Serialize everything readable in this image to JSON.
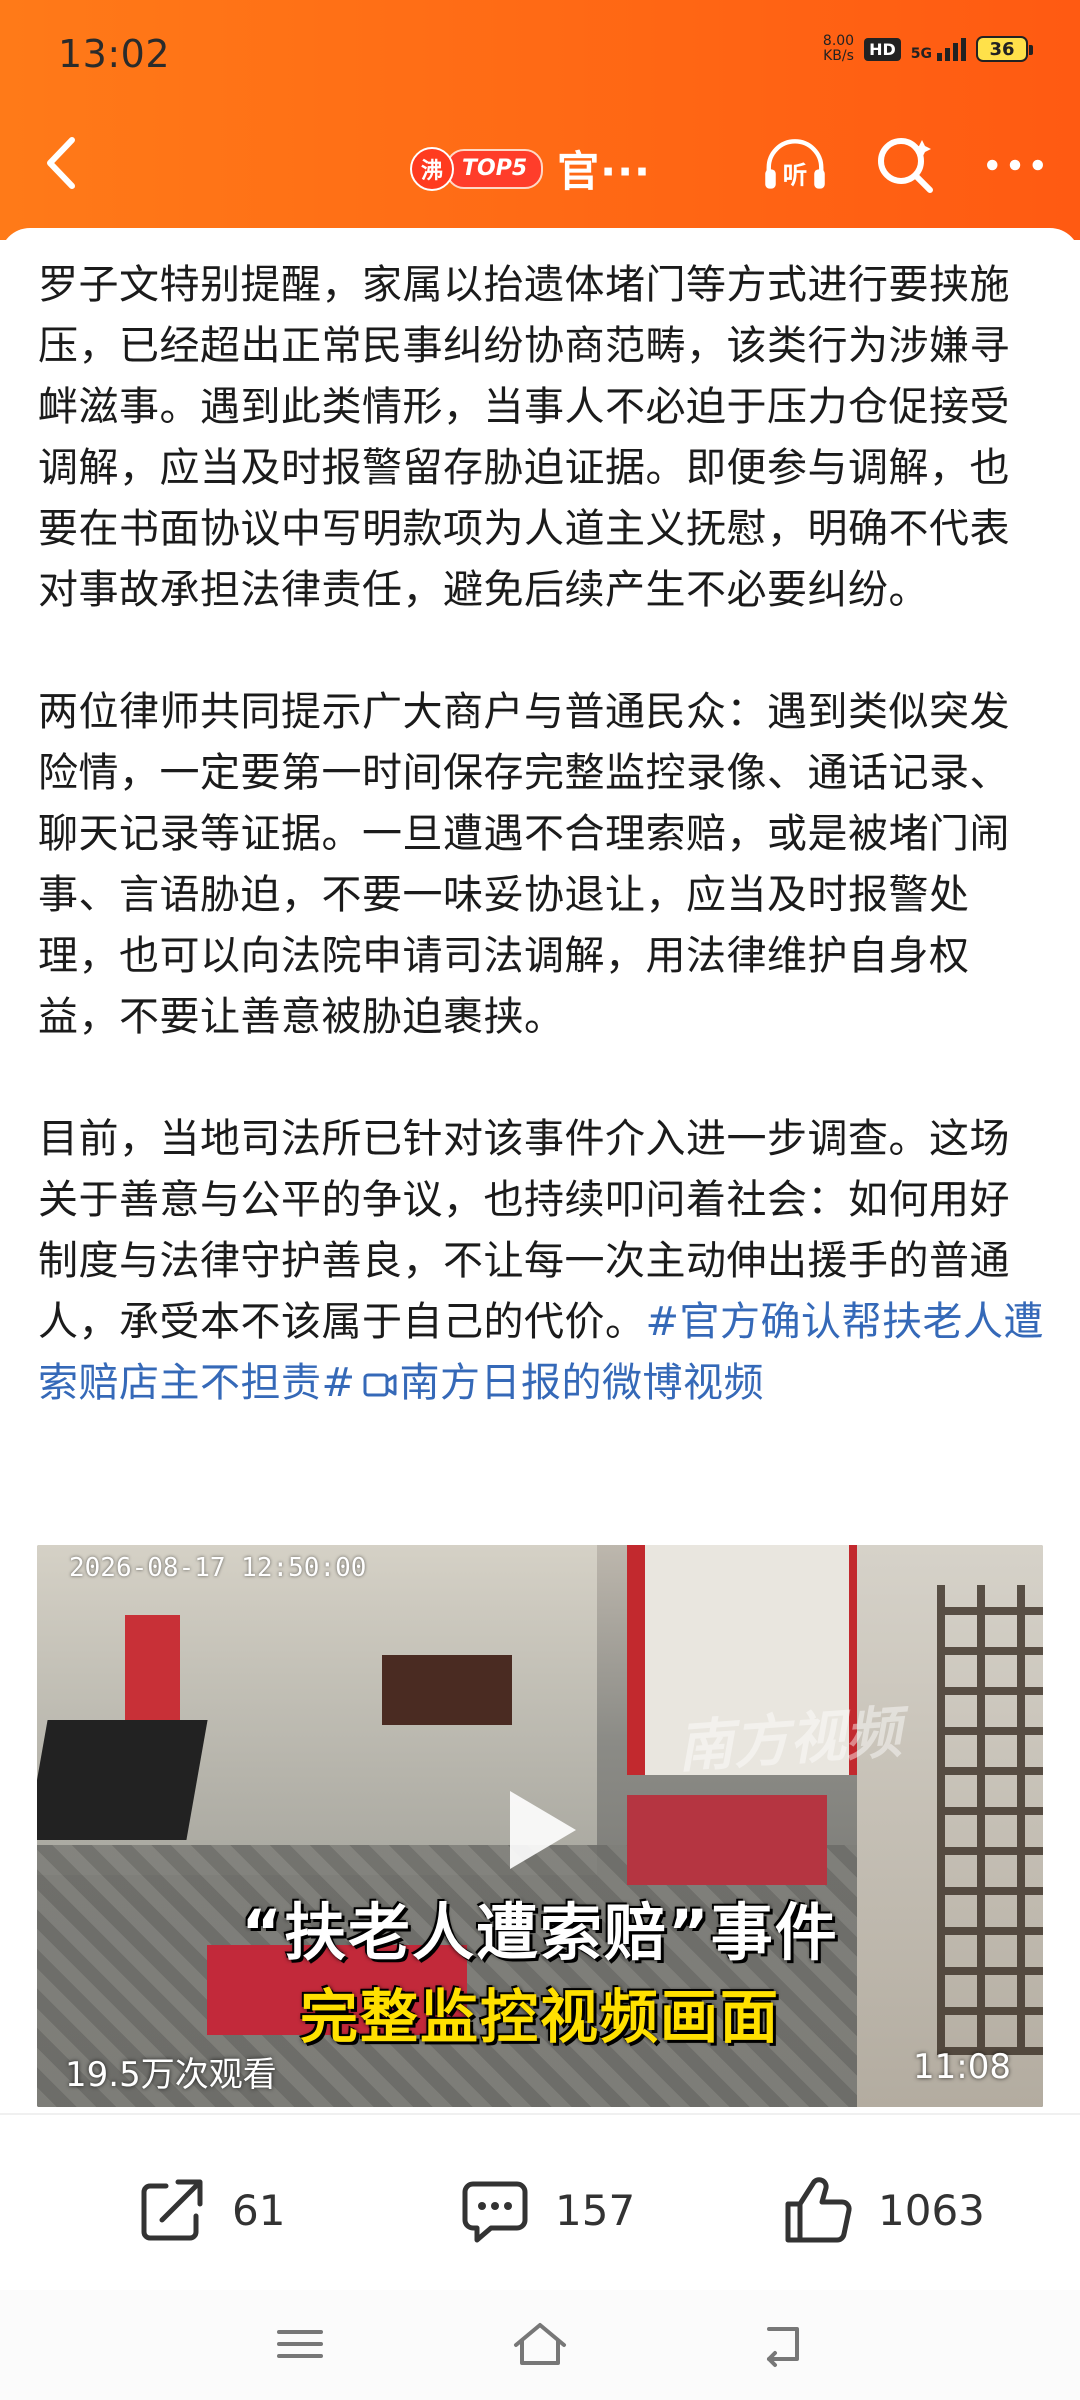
{
  "status_bar": {
    "time": "13:02",
    "net_speed_value": "8.00",
    "net_speed_unit": "KB/s",
    "hd_label": "HD",
    "network": "5G",
    "battery": "36"
  },
  "nav": {
    "logo_fire": "沸",
    "logo_badge": "TOP5",
    "title": "官···",
    "icons": [
      "back-icon",
      "listen-icon",
      "search-icon",
      "more-icon"
    ]
  },
  "article": {
    "paragraph_1": "罗子文特别提醒，家属以抬遗体堵门等方式进行要挟施压，已经超出正常民事纠纷协商范畴，该类行为涉嫌寻衅滋事。遇到此类情形，当事人不必迫于压力仓促接受调解，应当及时报警留存胁迫证据。即便参与调解，也要在书面协议中写明款项为人道主义抚慰，明确不代表对事故承担法律责任，避免后续产生不必要纠纷。",
    "paragraph_2": "两位律师共同提示广大商户与普通民众：遇到类似突发险情，一定要第一时间保存完整监控录像、通话记录、聊天记录等证据。一旦遭遇不合理索赔，或是被堵门闹事、言语胁迫，不要一味妥协退让，应当及时报警处理，也可以向法院申请司法调解，用法律维护自身权益，不要让善意被胁迫裹挟。",
    "paragraph_3_text": "目前，当地司法所已针对该事件介入进一步调查。这场关于善意与公平的争议，也持续叩问着社会：如何用好制度与法律守护善良，不让每一次主动伸出援手的普通人，承受本不该属于自己的代价。",
    "hashtag": "#官方确认帮扶老人遭索赔店主不担责#",
    "video_link": "南方日报的微博视频"
  },
  "video": {
    "timestamp": "2026-08-17 12:50:00",
    "watermark": "南方视频",
    "caption_line1": "“扶老人遭索赔”事件",
    "caption_line2": "完整监控视频画面",
    "views": "19.5万次观看",
    "duration": "11:08"
  },
  "actions": {
    "share_count": "61",
    "comment_count": "157",
    "like_count": "1063"
  },
  "colors": {
    "header_orange": "#ff6a15",
    "link_blue": "#3569b8",
    "caption_yellow": "#ffe000"
  }
}
